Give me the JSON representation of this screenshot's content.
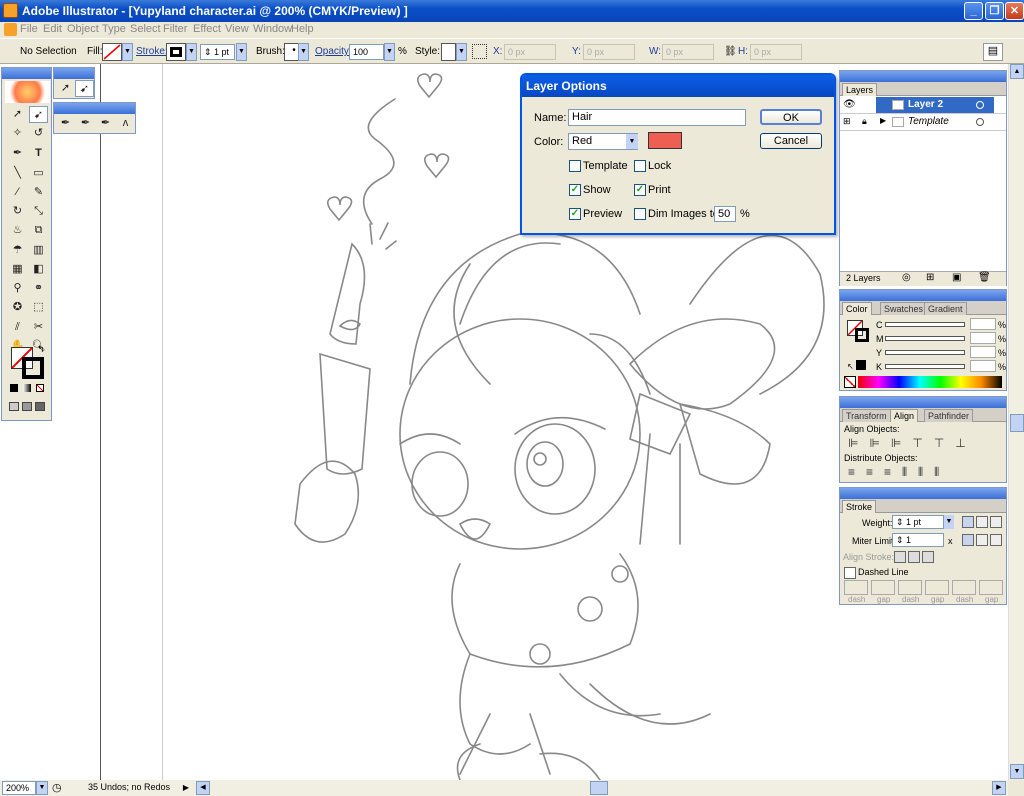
{
  "window": {
    "title": "Adobe Illustrator - [Yupyland character.ai @ 200% (CMYK/Preview) ]",
    "buttons": [
      "_",
      "❐",
      "✕"
    ]
  },
  "menu": [
    "File",
    "Edit",
    "Object",
    "Type",
    "Select",
    "Filter",
    "Effect",
    "View",
    "Window",
    "Help"
  ],
  "control_bar": {
    "selection": "No Selection",
    "fill_label": "Fill:",
    "stroke_label": "Stroke:",
    "stroke_weight": "1 pt",
    "brush_label": "Brush:",
    "opacity_label": "Opacity:",
    "opacity_value": "100",
    "opacity_unit": "%",
    "style_label": "Style:",
    "x_label": "X:",
    "x_value": "0 px",
    "y_label": "Y:",
    "y_value": "0 px",
    "w_label": "W:",
    "w_value": "0 px",
    "h_label": "H:",
    "h_value": "0 px"
  },
  "dialog": {
    "title": "Layer Options",
    "name_label": "Name:",
    "name_value": "Hair",
    "color_label": "Color:",
    "color_value": "Red",
    "swatch_color": "#ee5e52",
    "ok": "OK",
    "cancel": "Cancel",
    "template": "Template",
    "lock": "Lock",
    "show": "Show",
    "print": "Print",
    "preview": "Preview",
    "dim": "Dim Images to:",
    "dim_value": "50",
    "dim_unit": "%"
  },
  "layers_panel": {
    "title": "Layers",
    "layers": [
      {
        "name": "Layer 2"
      },
      {
        "name": "Template"
      }
    ],
    "footer": "2 Layers"
  },
  "color_panel": {
    "tabs": [
      "Color",
      "Swatches",
      "Gradient"
    ],
    "channels": [
      "C",
      "M",
      "Y",
      "K"
    ],
    "unit": "%"
  },
  "align_panel": {
    "tabs": [
      "Transform",
      "Align",
      "Pathfinder"
    ],
    "align_objects": "Align Objects:",
    "distribute_objects": "Distribute Objects:"
  },
  "stroke_panel": {
    "title": "Stroke",
    "weight_label": "Weight:",
    "weight_value": "1 pt",
    "miter_label": "Miter Limit:",
    "miter_value": "1",
    "miter_unit": "x",
    "align_stroke": "Align Stroke:",
    "dashed_line": "Dashed Line",
    "dash_labels": [
      "dash",
      "gap",
      "dash",
      "gap",
      "dash",
      "gap"
    ]
  },
  "status": {
    "zoom": "200%",
    "undo": "35 Undos; no Redos"
  },
  "accent": "#0a4fc8"
}
